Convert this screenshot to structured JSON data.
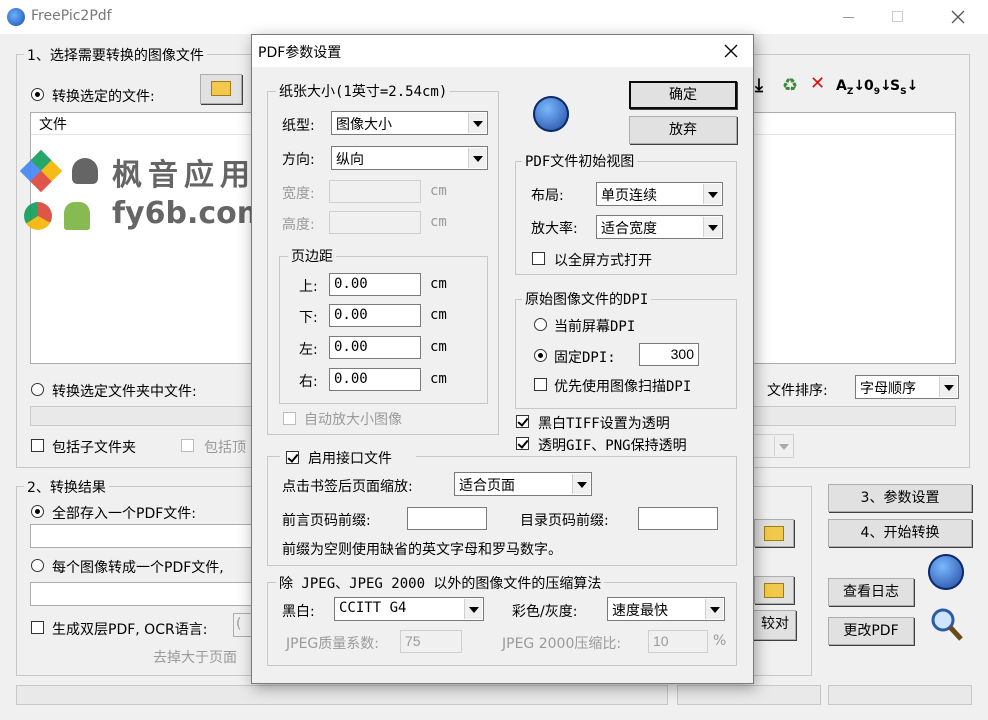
{
  "window": {
    "title": "FreePic2Pdf"
  },
  "main": {
    "section1_label": "1、选择需要转换的图像文件",
    "convert_selected_files": "转换选定的文件:",
    "file_column": "文件",
    "convert_folder_files": "转换选定文件夹中文件:",
    "include_subfolders": "包括子文件夹",
    "include_top_partial": "包括顶",
    "file_sort_label": "文件排序:",
    "file_sort_value": "字母顺序",
    "section2_label": "2、转换结果",
    "all_to_one_pdf": "全部存入一个PDF文件:",
    "each_to_pdf": "每个图像转成一个PDF文件,",
    "dual_layer_ocr": "生成双层PDF, OCR语言:",
    "ocr_partial": "(",
    "remove_larger_partial": "去掉大于页面",
    "compare_partial": "较对",
    "btn_params": "3、参数设置",
    "btn_start": "4、开始转换",
    "btn_log": "查看日志",
    "btn_modify": "更改PDF"
  },
  "watermark": {
    "line1": "枫音应用",
    "line2": "fy6b.com"
  },
  "dialog": {
    "title": "PDF参数设置",
    "ok": "确定",
    "cancel": "放弃",
    "paper_group": "纸张大小(1英寸=2.54cm)",
    "paper_type_label": "纸型:",
    "paper_type_value": "图像大小",
    "orientation_label": "方向:",
    "orientation_value": "纵向",
    "width_label": "宽度:",
    "height_label": "高度:",
    "unit": "cm",
    "margin_group": "页边距",
    "top_label": "上:",
    "bottom_label": "下:",
    "left_label": "左:",
    "right_label": "右:",
    "top_value": "0.00",
    "bottom_value": "0.00",
    "left_value": "0.00",
    "right_value": "0.00",
    "auto_scale": "自动放大小图像",
    "initial_view_group": "PDF文件初始视图",
    "layout_label": "布局:",
    "layout_value": "单页连续",
    "zoom_label": "放大率:",
    "zoom_value": "适合宽度",
    "fullscreen": "以全屏方式打开",
    "dpi_group": "原始图像文件的DPI",
    "dpi_screen": "当前屏幕DPI",
    "dpi_fixed": "固定DPI:",
    "dpi_value": "300",
    "dpi_scan": "优先使用图像扫描DPI",
    "tiff_transparent": "黑白TIFF设置为透明",
    "gif_png_transparent": "透明GIF、PNG保持透明",
    "interface_file": "启用接口文件",
    "bookmark_zoom_label": "点击书签后页面缩放:",
    "bookmark_zoom_value": "适合页面",
    "preface_prefix_label": "前言页码前缀:",
    "toc_prefix_label": "目录页码前缀:",
    "prefix_note": "前缀为空则使用缺省的英文字母和罗马数字。",
    "compression_group": "除 JPEG、JPEG 2000 以外的图像文件的压缩算法",
    "bw_label": "黑白:",
    "bw_value": "CCITT G4",
    "color_label": "彩色/灰度:",
    "color_value": "速度最快",
    "jpeg_quality_label": "JPEG质量系数:",
    "jpeg_quality_value": "75",
    "jpeg2000_label": "JPEG 2000压缩比:",
    "jpeg2000_value": "10",
    "percent": "%"
  }
}
